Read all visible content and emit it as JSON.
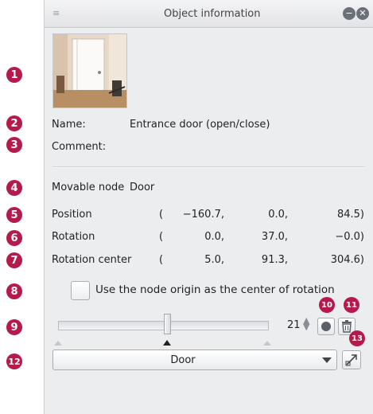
{
  "badges": [
    "1",
    "2",
    "3",
    "4",
    "5",
    "6",
    "7",
    "8",
    "9",
    "10",
    "11",
    "12",
    "13"
  ],
  "window": {
    "title": "Object information"
  },
  "fields": {
    "name_label": "Name:",
    "name_value": "Entrance door (open/close)",
    "comment_label": "Comment:",
    "movable_node_label": "Movable node",
    "movable_node_value": "Door"
  },
  "rows": [
    {
      "label": "Position",
      "open": "(",
      "v1": "−160.7,",
      "v2": "0.0,",
      "v3": "84.5)"
    },
    {
      "label": "Rotation",
      "open": "(",
      "v1": "0.0,",
      "v2": "37.0,",
      "v3": "−0.0)"
    },
    {
      "label": "Rotation center",
      "open": "(",
      "v1": "5.0,",
      "v2": "91.3,",
      "v3": "304.6)"
    }
  ],
  "checkbox": {
    "label": "Use the node origin as the center of rotation",
    "checked": false
  },
  "slider": {
    "value": "21",
    "level": 0.53
  },
  "dropdown": {
    "selected": "Door"
  },
  "icons": {
    "window_menu": "panel-menu-icon",
    "minimize": "minimize-icon",
    "close": "close-icon",
    "record": "record-dot-icon",
    "delete": "trash-icon",
    "node_tool": "node-select-icon"
  },
  "colors": {
    "badge": "#b51a4a",
    "panel": "#ecedef"
  }
}
